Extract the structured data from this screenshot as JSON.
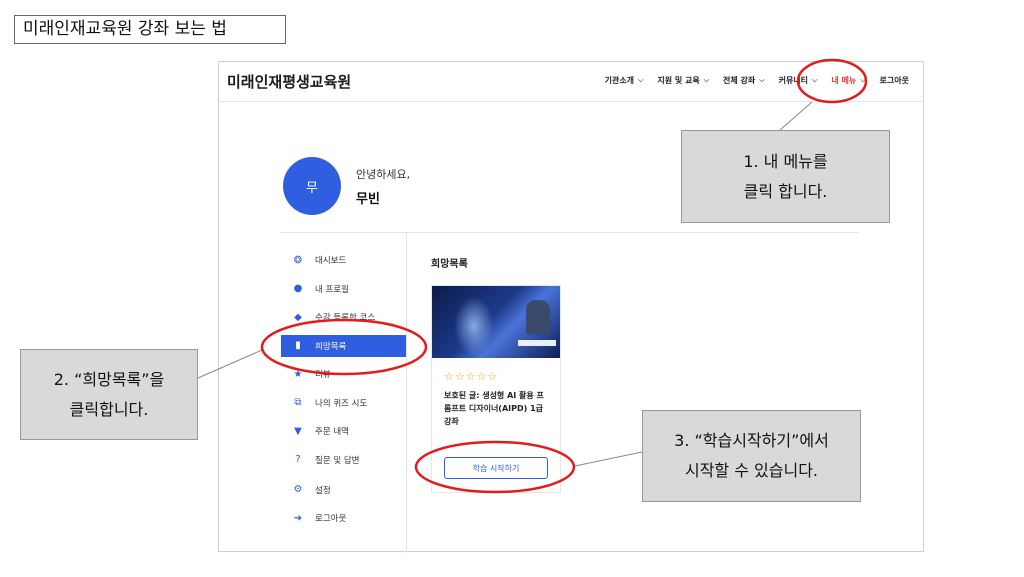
{
  "slide_title": "미래인재교육원 강좌 보는 법",
  "app": {
    "brand": "미래인재평생교육원",
    "menu": [
      {
        "label": "기관소개",
        "active": false
      },
      {
        "label": "지원 및 교육",
        "active": false
      },
      {
        "label": "전체 강좌",
        "active": false
      },
      {
        "label": "커뮤니티",
        "active": false
      },
      {
        "label": "내 메뉴",
        "active": true
      }
    ],
    "logout_label": "로그아웃",
    "profile": {
      "avatar_initial": "무",
      "greeting": "안녕하세요,",
      "name": "무빈"
    },
    "sidebar": {
      "items": [
        {
          "label": "대시보드",
          "icon": "dashboard-icon",
          "glyph": "❂"
        },
        {
          "label": "내 프로필",
          "icon": "user-icon",
          "glyph": "👤"
        },
        {
          "label": "수강 등록한 코스",
          "icon": "graduation-cap-icon",
          "glyph": "🎓"
        },
        {
          "label": "희망목록",
          "icon": "bookmark-icon",
          "glyph": "🔖",
          "active": true
        },
        {
          "label": "리뷰",
          "icon": "star-icon",
          "glyph": "★"
        },
        {
          "label": "나의 퀴즈 시도",
          "icon": "quiz-icon",
          "glyph": "⧉"
        },
        {
          "label": "주문 내역",
          "icon": "cart-icon",
          "glyph": "🛒"
        },
        {
          "label": "질문 및 답변",
          "icon": "question-icon",
          "glyph": "?"
        },
        {
          "label": "설정",
          "icon": "gear-icon",
          "glyph": "⚙"
        },
        {
          "label": "로그아웃",
          "icon": "logout-icon",
          "glyph": "➜"
        }
      ]
    },
    "wishlist": {
      "title": "희망목록",
      "course": {
        "rating_stars": "☆☆☆☆☆",
        "title": "보호된 글: 생성형 AI 활용 프롬프트 디자이너(AIPD) 1급 강좌",
        "start_label": "학습 시작하기"
      }
    }
  },
  "callouts": {
    "step1": {
      "line1": "1.  내 메뉴를",
      "line2": "클릭 합니다."
    },
    "step2": {
      "line1": "2. “희망목록”을",
      "line2": "클릭합니다."
    },
    "step3": {
      "line1": "3. “학습시작하기”에서",
      "line2": "시작할 수 있습니다."
    }
  },
  "colors": {
    "accent": "#2f5fe0",
    "highlight_red": "#e51b1b",
    "menu_active": "#e53935",
    "callout_bg": "#d9d9d9"
  }
}
